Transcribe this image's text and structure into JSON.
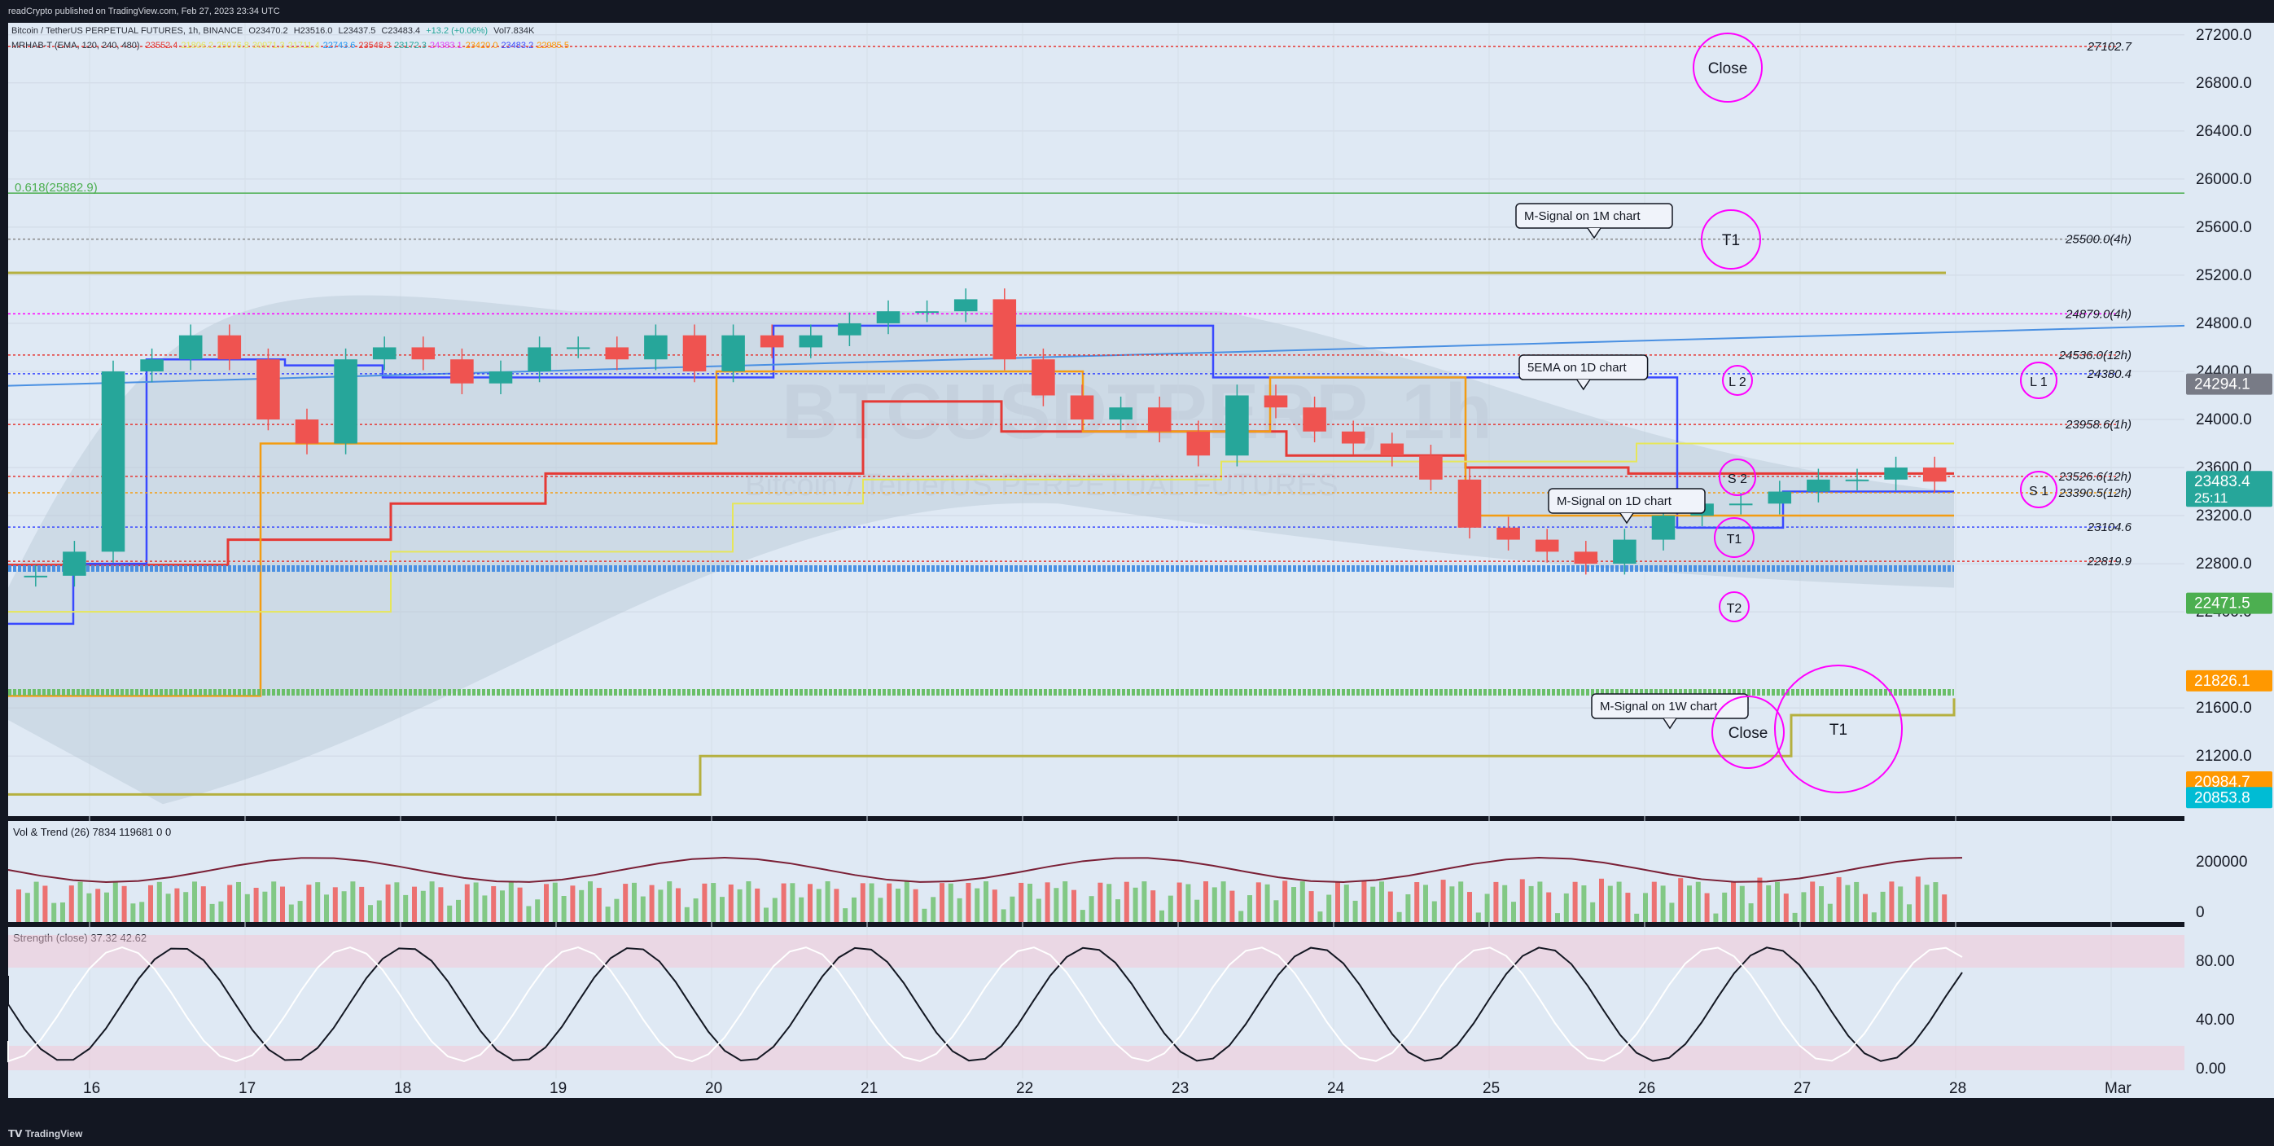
{
  "header": {
    "published": "readCrypto published on TradingView.com, Feb 27, 2023 23:34 UTC"
  },
  "footer": {
    "brand": "TradingView"
  },
  "legend": {
    "symbol_line": "Bitcoin / TetherUS PERPETUAL FUTURES, 1h, BINANCE",
    "ohlc": {
      "open": "O23470.2",
      "high": "H23516.0",
      "low": "L23437.5",
      "close": "C23483.4",
      "change": "+13.2 (+0.06%)",
      "volume": "Vol7.834K"
    },
    "mrhab_line": "MRHAB-T (EMA, 120, 240, 480)",
    "mrhab_values": [
      "23552.4",
      "21806.2",
      "25076.8",
      "30971.3",
      "21711.4",
      "22743.6",
      "23548.3",
      "23172.3",
      "24383.1",
      "23420.0",
      "23483.2",
      "22985.5"
    ],
    "vol_trend": "Vol & Trend (26)",
    "vol_values": [
      "7834",
      "119681",
      "0",
      "0"
    ],
    "strength": "Strength (close)",
    "strength_values": [
      "37.32",
      "42.62"
    ]
  },
  "watermark": {
    "ticker": "BTCUSDTPERP, 1h",
    "name": "Bitcoin / TetherUS PERPETUAL FUTURES"
  },
  "colors": {
    "background": "#dfe9f4",
    "red": "#e53935",
    "blue": "#3949ff",
    "orange": "#f39c12",
    "yellow": "#e6e65a",
    "olive": "#b5b03f",
    "magenta": "#ff00ff",
    "green_up": "#26a69a",
    "red_down": "#ef5350"
  },
  "chart_data": [
    {
      "type": "line",
      "title": "Bitcoin / TetherUS PERPETUAL FUTURES, 1h, BINANCE",
      "x": [
        "16",
        "17",
        "18",
        "19",
        "20",
        "21",
        "22",
        "23",
        "24",
        "25",
        "26",
        "27",
        "28",
        "Mar"
      ],
      "ylim": [
        20700,
        27300
      ],
      "y_ticks": [
        "27200.0",
        "26800.0",
        "26400.0",
        "26000.0",
        "25600.0",
        "25200.0",
        "24800.0",
        "24400.0",
        "24000.0",
        "23600.0",
        "23200.0",
        "22800.0",
        "22400.0",
        "21600.0",
        "21200.0"
      ],
      "series": [
        {
          "name": "close",
          "values": [
            22700,
            22900,
            24400,
            24500,
            24700,
            24500,
            24000,
            23800,
            24500,
            24600,
            24500,
            24300,
            24400,
            24600,
            24600,
            24500,
            24700,
            24400,
            24700,
            24600,
            24700,
            24800,
            24900,
            24900,
            25000,
            24500,
            24200,
            24000,
            24100,
            23900,
            23700,
            24200,
            24100,
            23900,
            23800,
            23700,
            23500,
            23100,
            23000,
            22900,
            22800,
            23000,
            23200,
            23300,
            23300,
            23400,
            23500,
            23500,
            23600,
            23483
          ]
        }
      ],
      "price_labels": [
        {
          "value": 27102.7,
          "text": "27102.7",
          "color": "red"
        },
        {
          "value": 25500.0,
          "text": "25500.0(4h)",
          "color": "gray"
        },
        {
          "value": 24879.0,
          "text": "24879.0(4h)",
          "color": "magenta"
        },
        {
          "value": 24536.0,
          "text": "24536.0(12h)",
          "color": "red"
        },
        {
          "value": 24380.4,
          "text": "24380.4",
          "color": "blue"
        },
        {
          "value": 23958.6,
          "text": "23958.6(1h)",
          "color": "red"
        },
        {
          "value": 23526.6,
          "text": "23526.6(12h)",
          "color": "red"
        },
        {
          "value": 23390.5,
          "text": "23390.5(12h)",
          "color": "orange"
        },
        {
          "value": 23104.6,
          "text": "23104.6",
          "color": "blue"
        },
        {
          "value": 22819.9,
          "text": "22819.9",
          "color": "red"
        }
      ],
      "axis_badges": [
        {
          "value": 24294.1,
          "text": "24294.1",
          "bg": "#787b86"
        },
        {
          "value": 23483.4,
          "text": "23483.4",
          "sub": "25:11",
          "bg": "#26a69a"
        },
        {
          "value": 22471.5,
          "text": "22471.5",
          "bg": "#4caf50"
        },
        {
          "value": 21826.1,
          "text": "21826.1",
          "bg": "#ff9800"
        },
        {
          "value": 20984.7,
          "text": "20984.7",
          "bg": "#ff9800"
        },
        {
          "value": 20853.8,
          "text": "20853.8",
          "bg": "#00bcd4"
        }
      ],
      "fib": {
        "value": 25882.9,
        "text": "0.618(25882.9)"
      },
      "annotations": [
        {
          "text": "M-Signal on 1M chart"
        },
        {
          "text": "5EMA on 1D chart"
        },
        {
          "text": "M-Signal on 1D chart"
        },
        {
          "text": "M-Signal on 1W chart"
        }
      ],
      "circles": [
        {
          "text": "Close",
          "value": 27100
        },
        {
          "text": "T1",
          "value": 25700
        },
        {
          "text": "L 2",
          "value": 24400
        },
        {
          "text": "L 1",
          "value": 24400
        },
        {
          "text": "S 2",
          "value": 23600
        },
        {
          "text": "S 1",
          "value": 23500
        },
        {
          "text": "T1",
          "value": 23000
        },
        {
          "text": "T2",
          "value": 22400
        },
        {
          "text": "Close",
          "value": 21600
        },
        {
          "text": "T1",
          "value": 21500
        }
      ]
    },
    {
      "type": "bar",
      "title": "Vol & Trend (26)",
      "y_ticks": [
        "200000",
        "0"
      ]
    },
    {
      "type": "line",
      "title": "Strength (close)",
      "y_ticks": [
        "80.00",
        "40.00",
        "0.00"
      ]
    }
  ]
}
